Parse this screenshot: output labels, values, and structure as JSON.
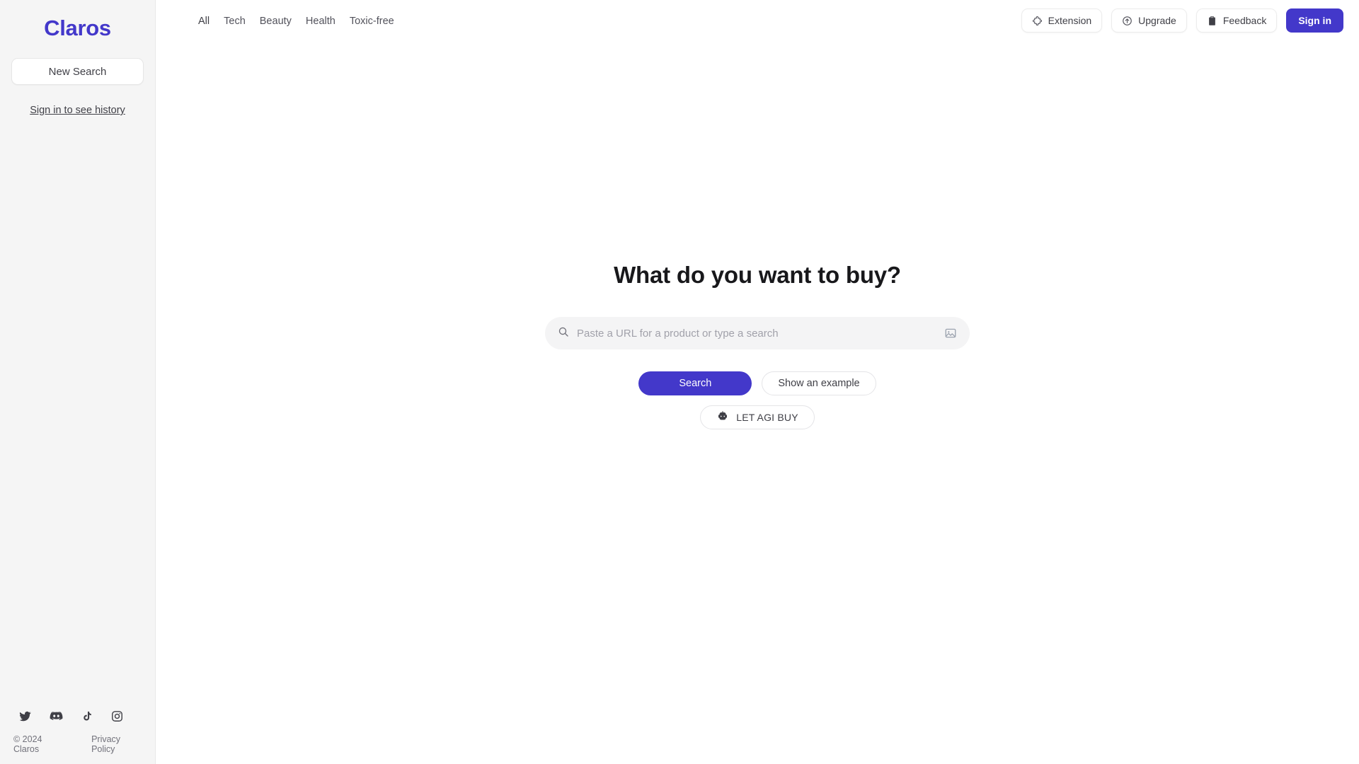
{
  "brand": {
    "name": "Claros"
  },
  "sidebar": {
    "new_search_label": "New Search",
    "history_link_label": "Sign in to see history",
    "socials": [
      {
        "name": "twitter",
        "label": "Twitter"
      },
      {
        "name": "discord",
        "label": "Discord"
      },
      {
        "name": "tiktok",
        "label": "TikTok"
      },
      {
        "name": "instagram",
        "label": "Instagram"
      }
    ],
    "footer": {
      "copyright": "© 2024 Claros",
      "privacy_label": "Privacy Policy"
    }
  },
  "topbar": {
    "tabs": [
      {
        "label": "All",
        "active": true
      },
      {
        "label": "Tech",
        "active": false
      },
      {
        "label": "Beauty",
        "active": false
      },
      {
        "label": "Health",
        "active": false
      },
      {
        "label": "Toxic-free",
        "active": false
      }
    ],
    "actions": {
      "extension_label": "Extension",
      "upgrade_label": "Upgrade",
      "feedback_label": "Feedback",
      "signin_label": "Sign in"
    },
    "icons": {
      "extension": "puzzle-piece-icon",
      "upgrade": "circle-arrow-up-icon",
      "feedback": "clipboard-icon"
    }
  },
  "hero": {
    "title": "What do you want to buy?",
    "search": {
      "value": "",
      "placeholder": "Paste a URL for a product or type a search",
      "left_icon": "search-icon",
      "right_icon": "image-upload-icon"
    },
    "primary_cta_label": "Search",
    "secondary_cta_label": "Show an example",
    "agi_cta_label": "LET AGI BUY",
    "agi_cta_icon": "robot-icon"
  },
  "colors": {
    "accent": "#4338ca",
    "sidebar_bg": "#f5f5f5",
    "main_bg": "#ffffff",
    "search_bg": "#f4f4f5",
    "muted_text": "#71717a"
  }
}
